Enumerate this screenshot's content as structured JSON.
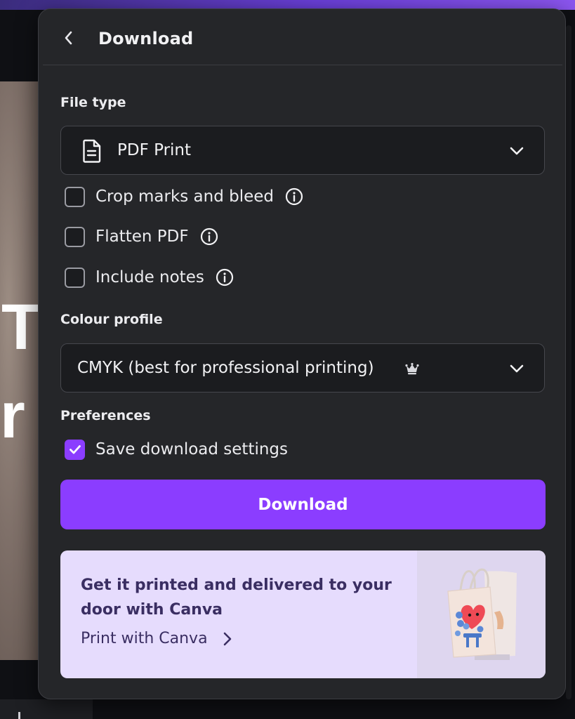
{
  "panel": {
    "title": "Download",
    "file_type": {
      "label": "File type",
      "selected": "PDF Print",
      "icon": "document-icon"
    },
    "options": [
      {
        "label": "Crop marks and bleed",
        "checked": false
      },
      {
        "label": "Flatten PDF",
        "checked": false
      },
      {
        "label": "Include notes",
        "checked": false
      }
    ],
    "colour_profile": {
      "label": "Colour profile",
      "selected": "CMYK (best for professional printing)",
      "badge_icon": "crown-icon"
    },
    "preferences": {
      "label": "Preferences",
      "save_settings_label": "Save download settings",
      "save_settings_checked": true
    },
    "download_button": "Download",
    "promo": {
      "heading": "Get it printed and delivered to your door with Canva",
      "link": "Print with Canva",
      "image": "tote-bag-heart-illustration"
    }
  },
  "background": {
    "canvas_letters": [
      "T",
      "r"
    ]
  },
  "colors": {
    "accent": "#8b3dff",
    "panel_bg": "#252629",
    "field_bg": "#1b1c1f",
    "promo_bg": "#e6dcfd",
    "promo_text": "#3a2e62"
  }
}
